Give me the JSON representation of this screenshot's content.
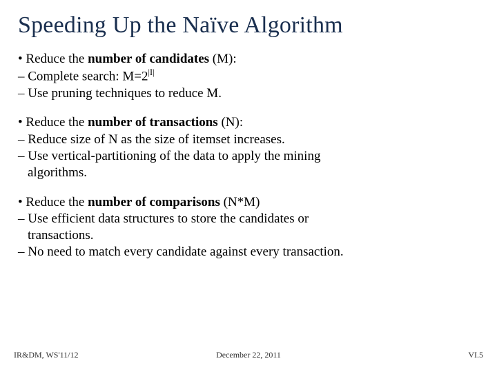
{
  "title": "Speeding Up the Naïve Algorithm",
  "groups": [
    {
      "lead": {
        "bullet": "• ",
        "pre": "Reduce the ",
        "bold": "number of candidates",
        "post": " (M):"
      },
      "subs": [
        {
          "dash": "– ",
          "txt": "Complete search: M=2",
          "sup": "|I|"
        },
        {
          "dash": "– ",
          "txt": "Use pruning techniques to reduce M."
        }
      ]
    },
    {
      "lead": {
        "bullet": "• ",
        "pre": "Reduce the ",
        "bold": "number of transactions",
        "post": " (N):"
      },
      "subs": [
        {
          "dash": "– ",
          "txt": "Reduce size of N as the size of itemset increases."
        },
        {
          "dash": "– ",
          "txt": "Use vertical-partitioning of the data to apply the mining",
          "cont": "algorithms."
        }
      ]
    },
    {
      "lead": {
        "bullet": "• ",
        "pre": "Reduce the ",
        "bold": "number of comparisons",
        "post": " (N*M)"
      },
      "subs": [
        {
          "dash": "– ",
          "txt": "Use efficient data structures to store the candidates or",
          "cont": "transactions."
        },
        {
          "dash": "– ",
          "txt": "No need to match every candidate against every transaction."
        }
      ]
    }
  ],
  "footer": {
    "left": "IR&DM, WS'11/12",
    "center": "December 22, 2011",
    "right": "VI.5"
  }
}
